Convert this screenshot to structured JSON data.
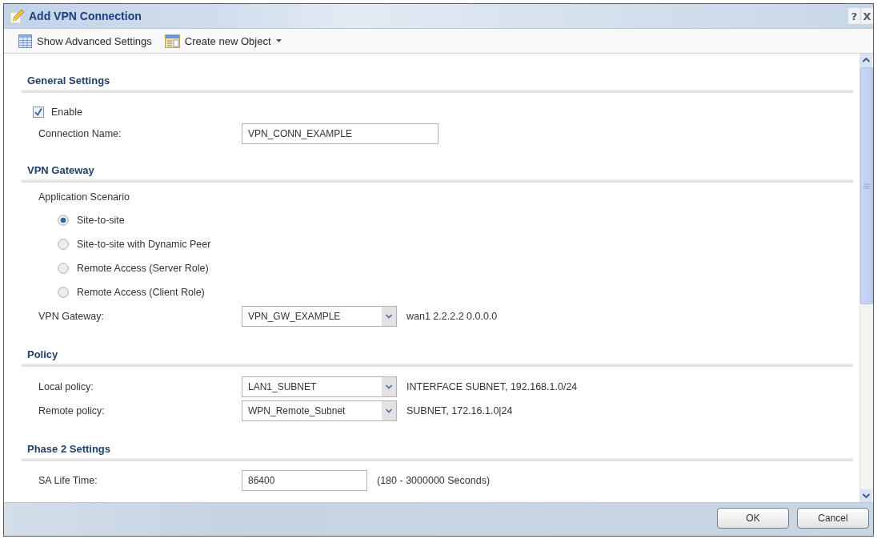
{
  "window": {
    "title": "Add VPN Connection",
    "help_button": "?",
    "close_button": "X"
  },
  "toolbar": [
    {
      "label": "Show Advanced Settings",
      "kind": "plain"
    },
    {
      "label": "Create new Object",
      "kind": "menu"
    }
  ],
  "sections": [
    {
      "title": "General Settings",
      "fields": [
        {
          "kind": "checkbox",
          "label": "Enable",
          "checked": true
        },
        {
          "kind": "text",
          "label": "Connection Name:",
          "value": "VPN_CONN_EXAMPLE"
        }
      ]
    },
    {
      "title": "VPN Gateway",
      "fields": [
        {
          "kind": "group_label",
          "label": "Application Scenario"
        },
        {
          "kind": "radio",
          "label": "Site-to-site",
          "selected": true
        },
        {
          "kind": "radio",
          "label": "Site-to-site with Dynamic Peer",
          "selected": false
        },
        {
          "kind": "radio",
          "label": "Remote Access (Server Role)",
          "selected": false
        },
        {
          "kind": "radio",
          "label": "Remote Access (Client Role)",
          "selected": false
        },
        {
          "kind": "select",
          "label": "VPN Gateway:",
          "value": "VPN_GW_EXAMPLE",
          "note": "wan1 2.2.2.2 0.0.0.0"
        }
      ]
    },
    {
      "title": "Policy",
      "fields": [
        {
          "kind": "select",
          "label": "Local policy:",
          "value": "LAN1_SUBNET",
          "note": "INTERFACE SUBNET, 192.168.1.0/24"
        },
        {
          "kind": "select",
          "label": "Remote policy:",
          "value": "WPN_Remote_Subnet",
          "note": "SUBNET, 172.16.1.0|24"
        }
      ]
    },
    {
      "title": "Phase 2 Settings",
      "fields": [
        {
          "kind": "text",
          "label": "SA Life Time:",
          "value": "86400",
          "note": "(180 - 3000000 Seconds)"
        }
      ]
    }
  ],
  "buttons": [
    {
      "label": "OK"
    },
    {
      "label": "Cancel"
    }
  ]
}
